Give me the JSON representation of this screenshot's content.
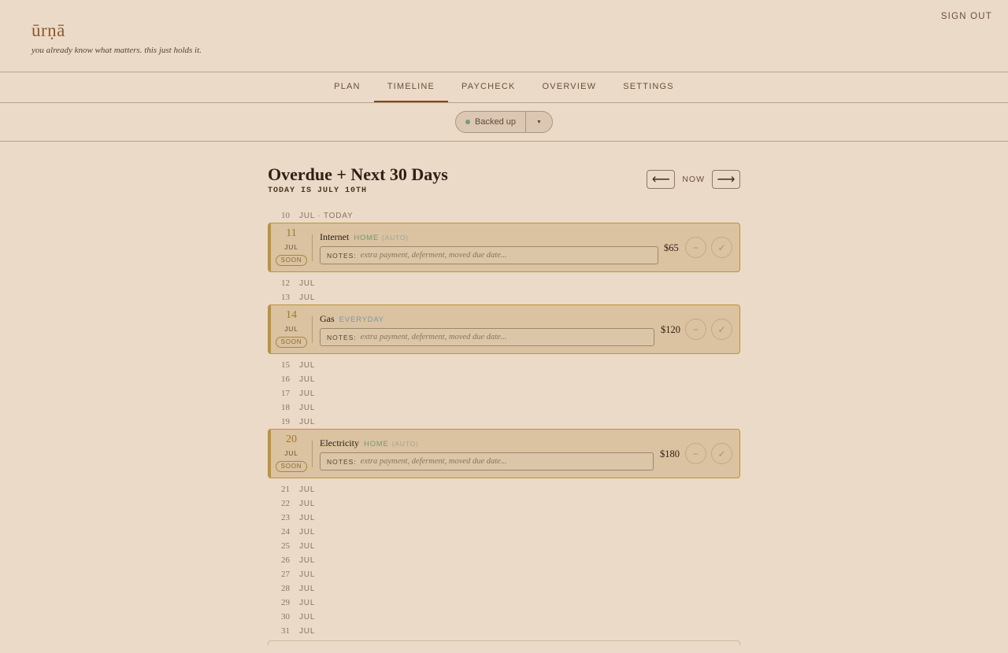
{
  "app": {
    "logo": "ūrṇā",
    "tagline": "you already know what matters. this just holds it.",
    "signout": "SIGN OUT"
  },
  "nav": {
    "tabs": [
      "PLAN",
      "TIMELINE",
      "PAYCHECK",
      "OVERVIEW",
      "SETTINGS"
    ],
    "active": "TIMELINE"
  },
  "backup": {
    "status": "Backed up",
    "caret": "▼",
    "status_color": "#7a9a80"
  },
  "main": {
    "title": "Overdue + Next 30 Days",
    "subtitle": "TODAY IS JULY 10TH",
    "prev": "⟵",
    "now": "NOW",
    "next": "⟶"
  },
  "timeline": {
    "today_row": {
      "day": "10",
      "label": "JUL · TODAY"
    },
    "notes_label": "NOTES:",
    "notes_placeholder": "extra payment, deferment, moved due date...",
    "skip_symbol": "−",
    "pay_symbol": "✓",
    "soon": "SOON",
    "bills": [
      {
        "day": "11",
        "month": "JUL",
        "name": "Internet",
        "category": "HOME",
        "auto": "(AUTO)",
        "amount": "$65"
      },
      {
        "day": "14",
        "month": "JUL",
        "name": "Gas",
        "category": "EVERYDAY",
        "auto": "",
        "amount": "$120"
      },
      {
        "day": "20",
        "month": "JUL",
        "name": "Electricity",
        "category": "HOME",
        "auto": "(AUTO)",
        "amount": "$180"
      }
    ],
    "empty_days": {
      "a": [
        {
          "day": "12",
          "mon": "JUL"
        },
        {
          "day": "13",
          "mon": "JUL"
        }
      ],
      "b": [
        {
          "day": "15",
          "mon": "JUL"
        },
        {
          "day": "16",
          "mon": "JUL"
        },
        {
          "day": "17",
          "mon": "JUL"
        },
        {
          "day": "18",
          "mon": "JUL"
        },
        {
          "day": "19",
          "mon": "JUL"
        }
      ],
      "c": [
        {
          "day": "21",
          "mon": "JUL"
        },
        {
          "day": "22",
          "mon": "JUL"
        },
        {
          "day": "23",
          "mon": "JUL"
        },
        {
          "day": "24",
          "mon": "JUL"
        },
        {
          "day": "25",
          "mon": "JUL"
        },
        {
          "day": "26",
          "mon": "JUL"
        },
        {
          "day": "27",
          "mon": "JUL"
        },
        {
          "day": "28",
          "mon": "JUL"
        },
        {
          "day": "29",
          "mon": "JUL"
        },
        {
          "day": "30",
          "mon": "JUL"
        },
        {
          "day": "31",
          "mon": "JUL"
        }
      ]
    }
  },
  "colors": {
    "background": "#ebdac7",
    "card": "#dbc2a0",
    "card_border": "#b89440",
    "home": "#6f9a78",
    "everyday": "#7a96b0",
    "active_tab": "#8b4513"
  }
}
